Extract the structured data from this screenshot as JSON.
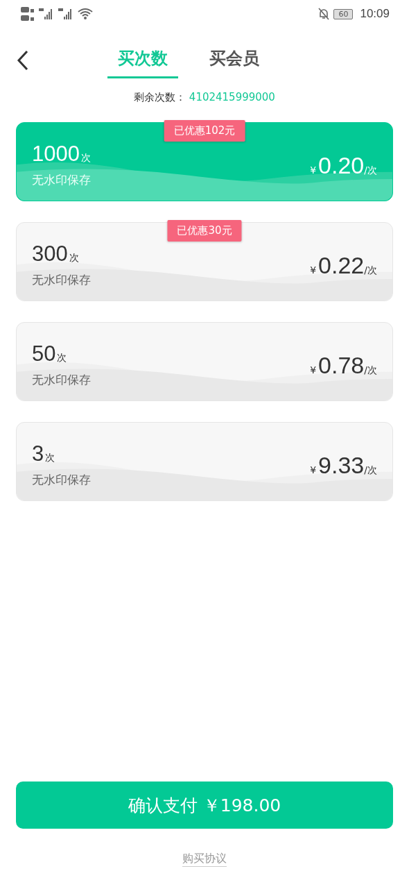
{
  "status_bar": {
    "battery": "60",
    "time": "10:09"
  },
  "tabs": [
    {
      "label": "买次数",
      "selected": true
    },
    {
      "label": "买会员",
      "selected": false
    }
  ],
  "remaining": {
    "label": "剩余次数：",
    "value": "4102415999000"
  },
  "packages": [
    {
      "count": "1000",
      "unit": "次",
      "desc": "无水印保存",
      "currency": "¥",
      "price": "0.20",
      "per": "/次",
      "badge": "已优惠102元",
      "selected": true
    },
    {
      "count": "300",
      "unit": "次",
      "desc": "无水印保存",
      "currency": "¥",
      "price": "0.22",
      "per": "/次",
      "badge": "已优惠30元",
      "selected": false
    },
    {
      "count": "50",
      "unit": "次",
      "desc": "无水印保存",
      "currency": "¥",
      "price": "0.78",
      "per": "/次",
      "selected": false
    },
    {
      "count": "3",
      "unit": "次",
      "desc": "无水印保存",
      "currency": "¥",
      "price": "9.33",
      "per": "/次",
      "selected": false
    }
  ],
  "pay_button": "确认支付 ￥198.00",
  "agreement_link": "购买协议"
}
